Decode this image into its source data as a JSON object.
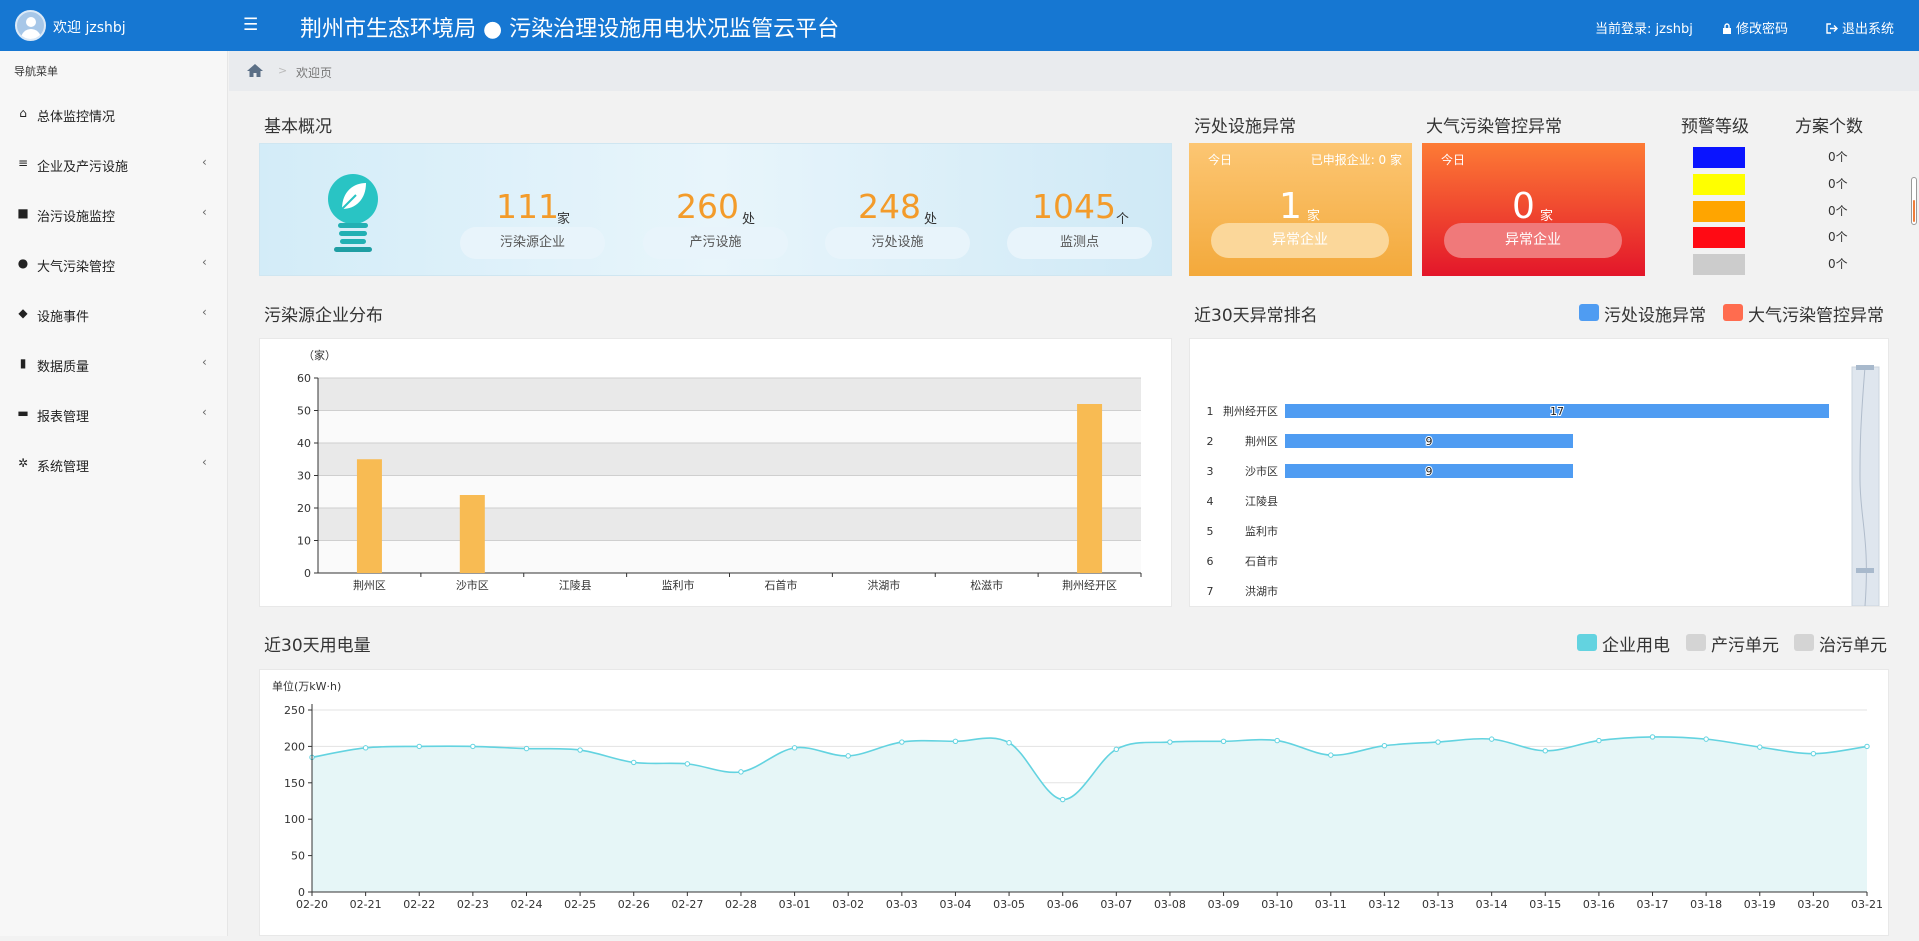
{
  "header": {
    "welcome": "欢迎 jzshbj",
    "menu_icon": "☰",
    "title": "荆州市生态环境局 ● 污染治理设施用电状况监管云平台",
    "current_user": "当前登录: jzshbj",
    "change_password": "修改密码",
    "logout": "退出系统"
  },
  "sidebar": {
    "heading": "导航菜单",
    "items": [
      {
        "label": "总体监控情况",
        "icon": "home-icon",
        "glyph": "⌂",
        "arrow": ""
      },
      {
        "label": "企业及产污设施",
        "icon": "list-icon",
        "glyph": "≡",
        "arrow": "‹"
      },
      {
        "label": "治污设施监控",
        "icon": "video-camera-icon",
        "glyph": "■",
        "arrow": "‹"
      },
      {
        "label": "大气污染管控",
        "icon": "globe-icon",
        "glyph": "●",
        "arrow": "‹"
      },
      {
        "label": "设施事件",
        "icon": "tags-icon",
        "glyph": "◆",
        "arrow": "‹"
      },
      {
        "label": "数据质量",
        "icon": "signal-icon",
        "glyph": "▮",
        "arrow": "‹"
      },
      {
        "label": "报表管理",
        "icon": "folder-open-icon",
        "glyph": "▬",
        "arrow": "‹"
      },
      {
        "label": "系统管理",
        "icon": "gear-icon",
        "glyph": "✲",
        "arrow": "‹"
      }
    ]
  },
  "breadcrumb": {
    "separator": ">",
    "current": "欢迎页"
  },
  "overview": {
    "title": "基本概况",
    "stats": [
      {
        "value": "111",
        "unit": "家",
        "label": "污染源企业"
      },
      {
        "value": "260",
        "unit": "处",
        "label": "产污设施"
      },
      {
        "value": "248",
        "unit": "处",
        "label": "污处设施"
      },
      {
        "value": "1045",
        "unit": "个",
        "label": "监测点"
      }
    ]
  },
  "facility_abnormal": {
    "title": "污处设施异常",
    "today": "今日",
    "reported": "已申报企业: 0 家",
    "value": "1",
    "unit": "家",
    "button": "异常企业"
  },
  "air_abnormal": {
    "title": "大气污染管控异常",
    "today": "今日",
    "value": "0",
    "unit": "家",
    "button": "异常企业"
  },
  "warning": {
    "level_title": "预警等级",
    "count_title": "方案个数",
    "levels": [
      {
        "color": "#0a14ff",
        "count": "0个"
      },
      {
        "color": "#ffff00",
        "count": "0个"
      },
      {
        "color": "#ffa500",
        "count": "0个"
      },
      {
        "color": "#ff0a14",
        "count": "0个"
      },
      {
        "color": "#cccccc",
        "count": "0个"
      }
    ]
  },
  "distribution": {
    "title": "污染源企业分布",
    "chart_data": {
      "type": "bar",
      "unit_label": "（家）",
      "categories": [
        "荆州区",
        "沙市区",
        "江陵县",
        "监利市",
        "石首市",
        "洪湖市",
        "松滋市",
        "荆州经开区"
      ],
      "values": [
        35,
        24,
        0,
        0,
        0,
        0,
        0,
        52
      ],
      "ylim": [
        0,
        60
      ],
      "yticks": [
        "0",
        "10",
        "20",
        "30",
        "40",
        "50",
        "60"
      ],
      "color": "#f8bb53"
    }
  },
  "ranking": {
    "title": "近30天异常排名",
    "legend": [
      {
        "name": "污处设施异常",
        "color": "#4f9cf2"
      },
      {
        "name": "大气污染管控异常",
        "color": "#ff6c4f"
      }
    ],
    "chart_data": {
      "type": "bar",
      "orientation": "horizontal",
      "ranks": [
        "1",
        "2",
        "3",
        "4",
        "5",
        "6",
        "7"
      ],
      "categories": [
        "荆州经开区",
        "荆州区",
        "沙市区",
        "江陵县",
        "监利市",
        "石首市",
        "洪湖市"
      ],
      "values": [
        17,
        9,
        9,
        0,
        0,
        0,
        0
      ],
      "xlim": [
        0,
        17
      ],
      "color": "#4f9cf2"
    }
  },
  "power": {
    "title": "近30天用电量",
    "legend": [
      {
        "name": "企业用电",
        "color": "#63d3e0"
      },
      {
        "name": "产污单元",
        "color": "#d4d4d4"
      },
      {
        "name": "治污单元",
        "color": "#d4d4d4"
      }
    ],
    "chart_data": {
      "type": "area",
      "ylabel": "单位(万kW·h)",
      "ylim": [
        0,
        250
      ],
      "yticks": [
        "0",
        "50",
        "100",
        "150",
        "200",
        "250"
      ],
      "x": [
        "02-20",
        "02-21",
        "02-22",
        "02-23",
        "02-24",
        "02-25",
        "02-26",
        "02-27",
        "02-28",
        "03-01",
        "03-02",
        "03-03",
        "03-04",
        "03-05",
        "03-06",
        "03-07",
        "03-08",
        "03-09",
        "03-10",
        "03-11",
        "03-12",
        "03-13",
        "03-14",
        "03-15",
        "03-16",
        "03-17",
        "03-18",
        "03-19",
        "03-20",
        "03-21"
      ],
      "series": [
        {
          "name": "企业用电",
          "values": [
            185,
            198,
            200,
            200,
            197,
            195,
            178,
            176,
            165,
            198,
            187,
            206,
            207,
            205,
            127,
            196,
            206,
            207,
            208,
            188,
            201,
            206,
            210,
            194,
            208,
            213,
            210,
            199,
            190,
            200
          ]
        }
      ],
      "color": "#63d3e0"
    }
  }
}
